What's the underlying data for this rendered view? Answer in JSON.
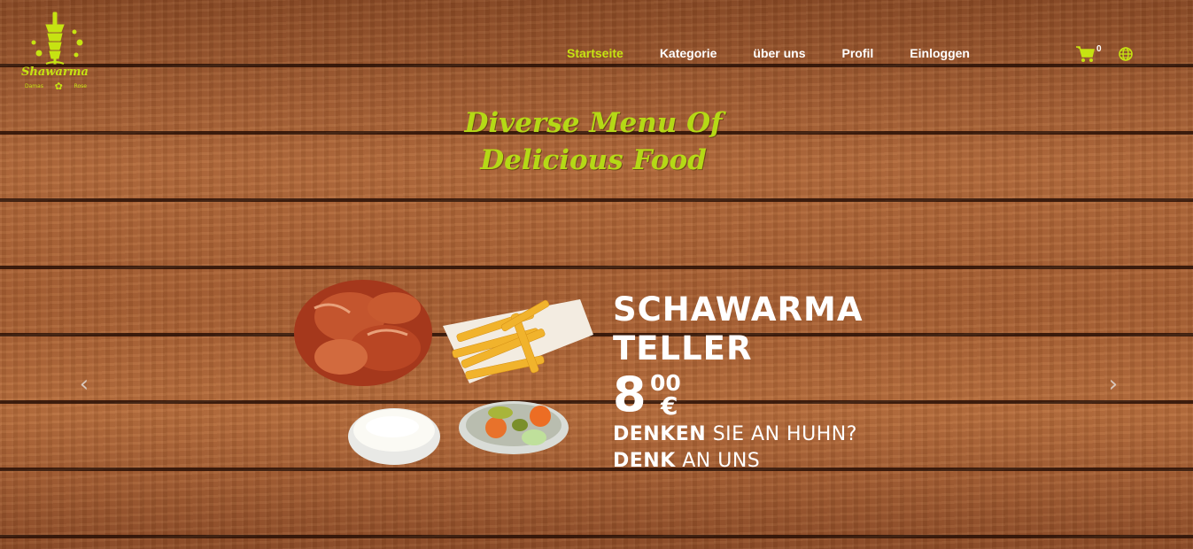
{
  "brand": {
    "name": "Shawarma",
    "sub_left": "Damas",
    "sub_right": "Rose",
    "accent": "#c6e312"
  },
  "nav": {
    "items": [
      {
        "label": "Startseite",
        "active": true
      },
      {
        "label": "Kategorie",
        "active": false
      },
      {
        "label": "über uns",
        "active": false
      },
      {
        "label": "Profil",
        "active": false
      },
      {
        "label": "Einloggen",
        "active": false
      }
    ]
  },
  "cart": {
    "count": "0",
    "icon": "cart-icon"
  },
  "language": {
    "icon": "globe-icon"
  },
  "hero": {
    "headline_line1": "Diverse Menu Of",
    "headline_line2": "Delicious Food"
  },
  "slide": {
    "title_line1": "SCHAWARMA",
    "title_line2": "TELLER",
    "price_main": "8",
    "price_cents": "00",
    "price_currency": "€",
    "tag1_bold": "DENKEN",
    "tag1_rest": " SIE AN HUHN?",
    "tag2_bold": "DENK",
    "tag2_rest": " AN UNS"
  },
  "carousel": {
    "prev": "‹",
    "next": "›"
  }
}
